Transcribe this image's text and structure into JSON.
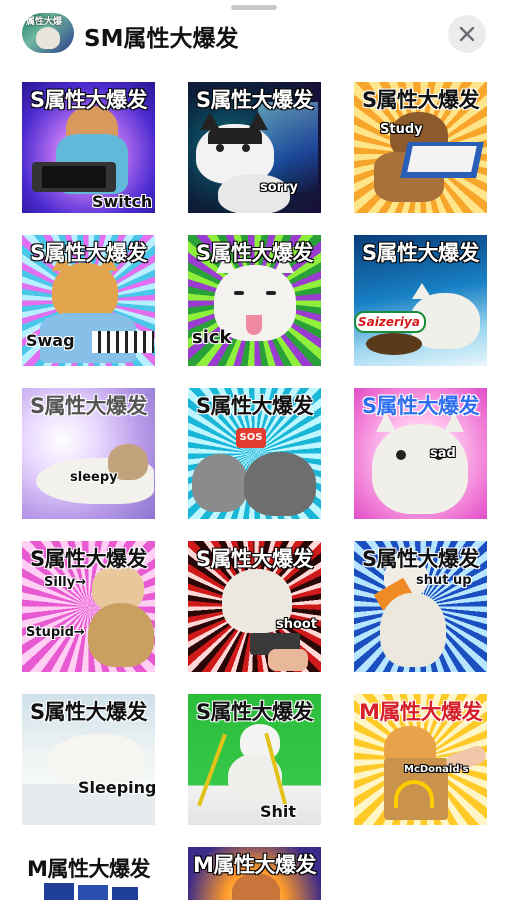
{
  "pack": {
    "title": "SM属性大爆发",
    "avatar_text": "属性大爆"
  },
  "stickers": [
    {
      "caption": "S属性大爆发",
      "label": "Switch"
    },
    {
      "caption": "S属性大爆发",
      "label": "sorry"
    },
    {
      "caption": "S属性大爆发",
      "label": "Study"
    },
    {
      "caption": "S属性大爆发",
      "label": "Swag"
    },
    {
      "caption": "S属性大爆发",
      "label": "sick"
    },
    {
      "caption": "S属性大爆发",
      "label": "Saizeriya"
    },
    {
      "caption": "S属性大爆发",
      "label": "sleepy"
    },
    {
      "caption": "S属性大爆发",
      "label": "SOS"
    },
    {
      "caption": "S属性大爆发",
      "label": "sad"
    },
    {
      "caption": "S属性大爆发",
      "label": "Silly→",
      "label2": "Stupid→"
    },
    {
      "caption": "S属性大爆发",
      "label": "shoot"
    },
    {
      "caption": "S属性大爆发",
      "label": "shut up"
    },
    {
      "caption": "S属性大爆发",
      "label": "Sleeping"
    },
    {
      "caption": "S属性大爆发",
      "label": "Shit"
    },
    {
      "caption": "M属性大爆发",
      "label": "McDonald's"
    },
    {
      "caption": "M属性大爆发"
    },
    {
      "caption": "M属性大爆发"
    }
  ]
}
